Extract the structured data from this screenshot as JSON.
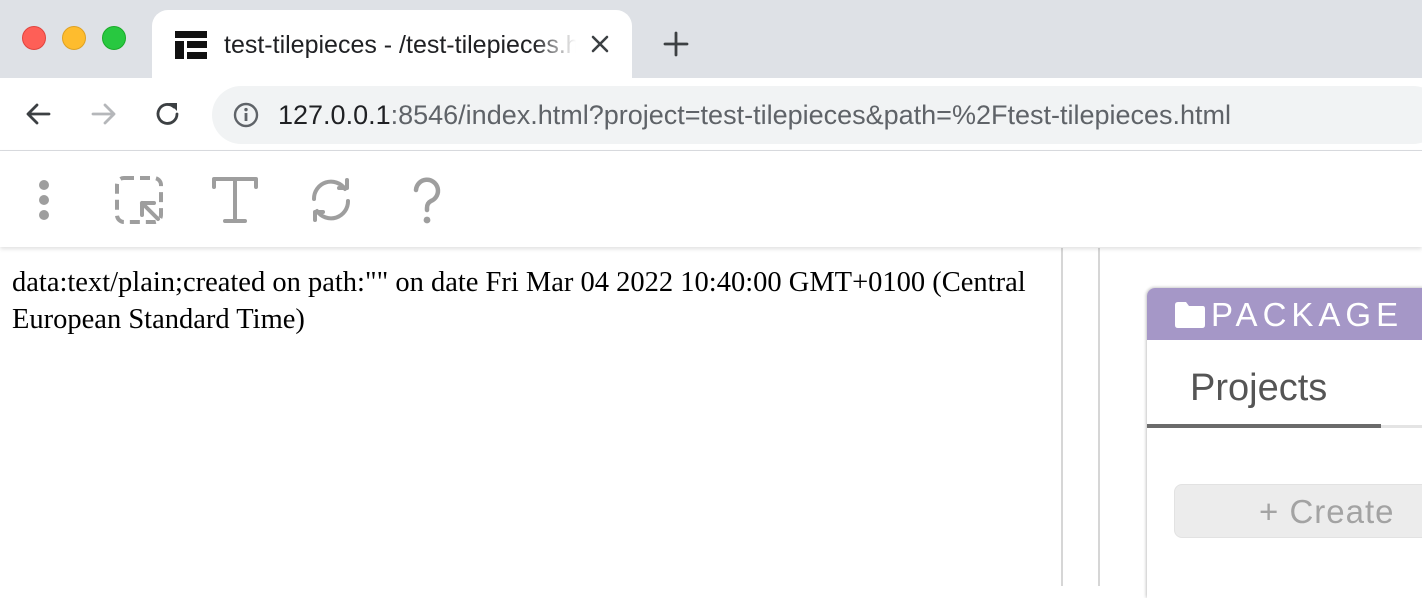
{
  "window": {
    "tab_title": "test-tilepieces - /test-tilepieces.html",
    "colors": {
      "tabstrip_bg": "#dee1e6",
      "close_button": "#fe5f57",
      "minimize_button": "#febc2e",
      "zoom_button": "#28c840"
    }
  },
  "icons": {
    "favicon": "tilepieces-logo-icon",
    "tab_close": "close-icon",
    "new_tab": "plus-icon",
    "back": "arrow-left-icon",
    "forward": "arrow-right-icon",
    "reload": "reload-icon",
    "site_info": "info-circle-icon",
    "menu": "vertical-dots-icon",
    "select": "dashed-select-arrow-icon",
    "text": "text-icon",
    "refresh": "refresh-icon",
    "help": "question-mark-icon",
    "folder": "folder-icon"
  },
  "address_bar": {
    "host": "127.0.0.1",
    "rest": ":8546/index.html?project=test-tilepieces&path=%2Ftest-tilepieces.html"
  },
  "content": {
    "text": "data:text/plain;created on path:\"\" on date Fri Mar 04 2022 10:40:00 GMT+0100 (Central European Standard Time)"
  },
  "panel": {
    "title": "PACKAGE",
    "accent_color": "#a597c7",
    "tab_label": "Projects",
    "create_label": "+ Create"
  }
}
